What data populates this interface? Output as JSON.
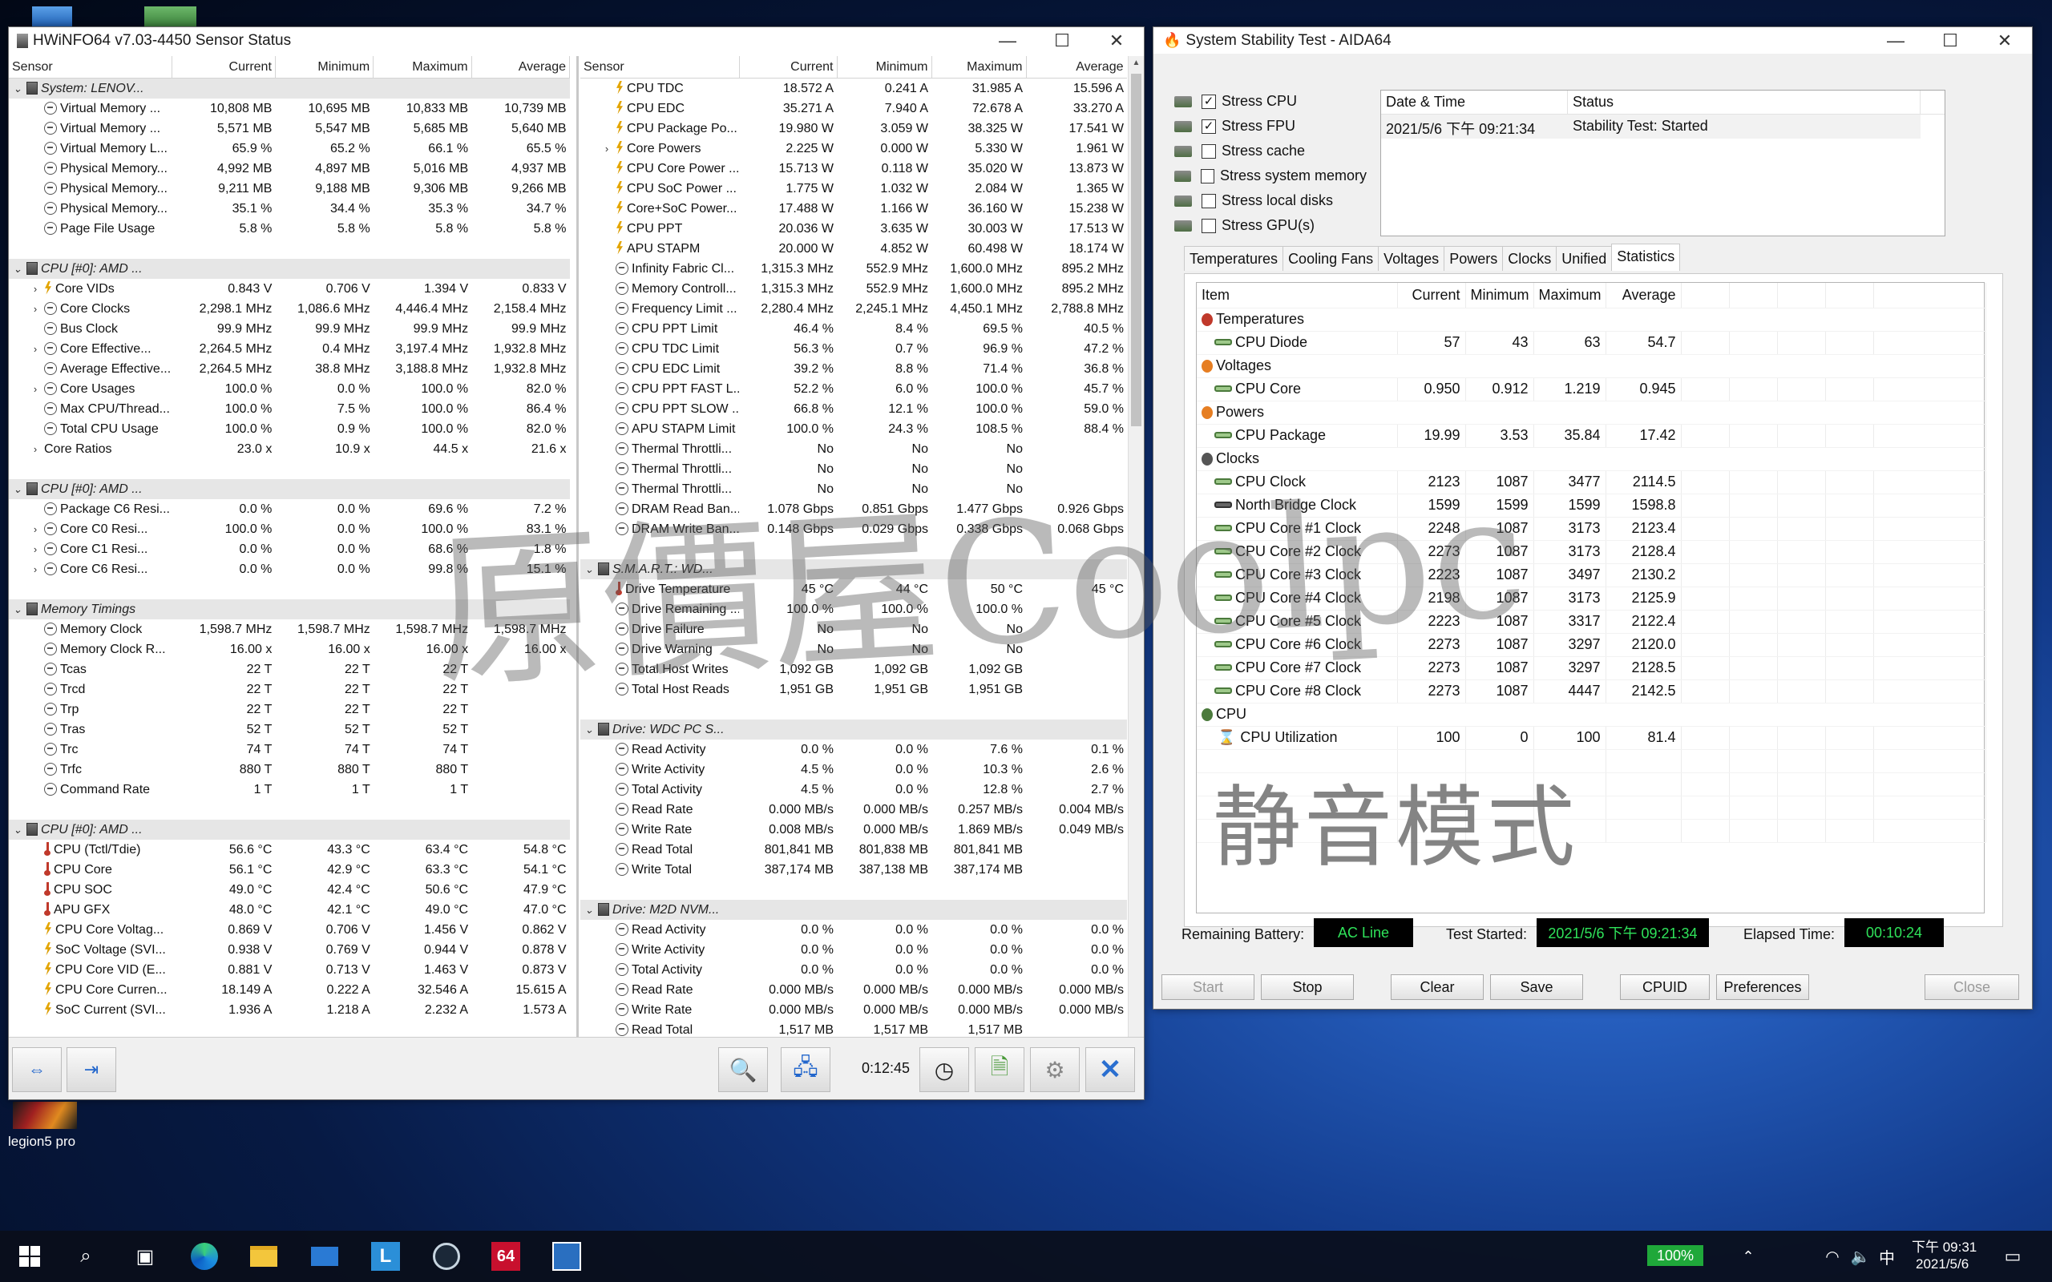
{
  "hwinfo": {
    "title": "HWiNFO64 v7.03-4450 Sensor Status",
    "columns": [
      "Sensor",
      "Current",
      "Minimum",
      "Maximum",
      "Average"
    ],
    "left_rows": [
      {
        "g": 1,
        "n": "System: LENOV..."
      },
      {
        "i": "clk",
        "n": "Virtual Memory ...",
        "v": [
          "10,808 MB",
          "10,695 MB",
          "10,833 MB",
          "10,739 MB"
        ]
      },
      {
        "i": "clk",
        "n": "Virtual Memory ...",
        "v": [
          "5,571 MB",
          "5,547 MB",
          "5,685 MB",
          "5,640 MB"
        ]
      },
      {
        "i": "clk",
        "n": "Virtual Memory L...",
        "v": [
          "65.9 %",
          "65.2 %",
          "66.1 %",
          "65.5 %"
        ]
      },
      {
        "i": "clk",
        "n": "Physical Memory...",
        "v": [
          "4,992 MB",
          "4,897 MB",
          "5,016 MB",
          "4,937 MB"
        ]
      },
      {
        "i": "clk",
        "n": "Physical Memory...",
        "v": [
          "9,211 MB",
          "9,188 MB",
          "9,306 MB",
          "9,266 MB"
        ]
      },
      {
        "i": "clk",
        "n": "Physical Memory...",
        "v": [
          "35.1 %",
          "34.4 %",
          "35.3 %",
          "34.7 %"
        ]
      },
      {
        "i": "clk",
        "n": "Page File Usage",
        "v": [
          "5.8 %",
          "5.8 %",
          "5.8 %",
          "5.8 %"
        ]
      },
      {
        "b": 1
      },
      {
        "g": 1,
        "n": "CPU [#0]: AMD ..."
      },
      {
        "x": 1,
        "i": "bolt",
        "n": "Core VIDs",
        "v": [
          "0.843 V",
          "0.706 V",
          "1.394 V",
          "0.833 V"
        ]
      },
      {
        "x": 1,
        "i": "clk",
        "n": "Core Clocks",
        "v": [
          "2,298.1 MHz",
          "1,086.6 MHz",
          "4,446.4 MHz",
          "2,158.4 MHz"
        ]
      },
      {
        "i": "clk",
        "n": "Bus Clock",
        "v": [
          "99.9 MHz",
          "99.9 MHz",
          "99.9 MHz",
          "99.9 MHz"
        ]
      },
      {
        "x": 1,
        "i": "clk",
        "n": "Core Effective...",
        "v": [
          "2,264.5 MHz",
          "0.4 MHz",
          "3,197.4 MHz",
          "1,932.8 MHz"
        ]
      },
      {
        "i": "clk",
        "n": "Average Effective...",
        "v": [
          "2,264.5 MHz",
          "38.8 MHz",
          "3,188.8 MHz",
          "1,932.8 MHz"
        ]
      },
      {
        "x": 1,
        "i": "clk",
        "n": "Core Usages",
        "v": [
          "100.0 %",
          "0.0 %",
          "100.0 %",
          "82.0 %"
        ]
      },
      {
        "i": "clk",
        "n": "Max CPU/Thread...",
        "v": [
          "100.0 %",
          "7.5 %",
          "100.0 %",
          "86.4 %"
        ]
      },
      {
        "i": "clk",
        "n": "Total CPU Usage",
        "v": [
          "100.0 %",
          "0.9 %",
          "100.0 %",
          "82.0 %"
        ]
      },
      {
        "x": 1,
        "n": "Core Ratios",
        "v": [
          "23.0 x",
          "10.9 x",
          "44.5 x",
          "21.6 x"
        ]
      },
      {
        "b": 1
      },
      {
        "g": 1,
        "n": "CPU [#0]: AMD ..."
      },
      {
        "i": "clk",
        "n": "Package C6 Resi...",
        "v": [
          "0.0 %",
          "0.0 %",
          "69.6 %",
          "7.2 %"
        ]
      },
      {
        "x": 1,
        "i": "clk",
        "n": "Core C0 Resi...",
        "v": [
          "100.0 %",
          "0.0 %",
          "100.0 %",
          "83.1 %"
        ]
      },
      {
        "x": 1,
        "i": "clk",
        "n": "Core C1 Resi...",
        "v": [
          "0.0 %",
          "0.0 %",
          "68.6 %",
          "1.8 %"
        ]
      },
      {
        "x": 1,
        "i": "clk",
        "n": "Core C6 Resi...",
        "v": [
          "0.0 %",
          "0.0 %",
          "99.8 %",
          "15.1 %"
        ]
      },
      {
        "b": 1
      },
      {
        "g": 1,
        "n": "Memory Timings"
      },
      {
        "i": "clk",
        "n": "Memory Clock",
        "v": [
          "1,598.7 MHz",
          "1,598.7 MHz",
          "1,598.7 MHz",
          "1,598.7 MHz"
        ]
      },
      {
        "i": "clk",
        "n": "Memory Clock R...",
        "v": [
          "16.00 x",
          "16.00 x",
          "16.00 x",
          "16.00 x"
        ]
      },
      {
        "i": "clk",
        "n": "Tcas",
        "v": [
          "22 T",
          "22 T",
          "22 T",
          ""
        ]
      },
      {
        "i": "clk",
        "n": "Trcd",
        "v": [
          "22 T",
          "22 T",
          "22 T",
          ""
        ]
      },
      {
        "i": "clk",
        "n": "Trp",
        "v": [
          "22 T",
          "22 T",
          "22 T",
          ""
        ]
      },
      {
        "i": "clk",
        "n": "Tras",
        "v": [
          "52 T",
          "52 T",
          "52 T",
          ""
        ]
      },
      {
        "i": "clk",
        "n": "Trc",
        "v": [
          "74 T",
          "74 T",
          "74 T",
          ""
        ]
      },
      {
        "i": "clk",
        "n": "Trfc",
        "v": [
          "880 T",
          "880 T",
          "880 T",
          ""
        ]
      },
      {
        "i": "clk",
        "n": "Command Rate",
        "v": [
          "1 T",
          "1 T",
          "1 T",
          ""
        ]
      },
      {
        "b": 1
      },
      {
        "g": 1,
        "n": "CPU [#0]: AMD ..."
      },
      {
        "i": "therm",
        "n": "CPU (Tctl/Tdie)",
        "v": [
          "56.6 °C",
          "43.3 °C",
          "63.4 °C",
          "54.8 °C"
        ]
      },
      {
        "i": "therm",
        "n": "CPU Core",
        "v": [
          "56.1 °C",
          "42.9 °C",
          "63.3 °C",
          "54.1 °C"
        ]
      },
      {
        "i": "therm",
        "n": "CPU SOC",
        "v": [
          "49.0 °C",
          "42.4 °C",
          "50.6 °C",
          "47.9 °C"
        ]
      },
      {
        "i": "therm",
        "n": "APU GFX",
        "v": [
          "48.0 °C",
          "42.1 °C",
          "49.0 °C",
          "47.0 °C"
        ]
      },
      {
        "i": "bolt",
        "n": "CPU Core Voltag...",
        "v": [
          "0.869 V",
          "0.706 V",
          "1.456 V",
          "0.862 V"
        ]
      },
      {
        "i": "bolt",
        "n": "SoC Voltage (SVI...",
        "v": [
          "0.938 V",
          "0.769 V",
          "0.944 V",
          "0.878 V"
        ]
      },
      {
        "i": "bolt",
        "n": "CPU Core VID (E...",
        "v": [
          "0.881 V",
          "0.713 V",
          "1.463 V",
          "0.873 V"
        ]
      },
      {
        "i": "bolt",
        "n": "CPU Core Curren...",
        "v": [
          "18.149 A",
          "0.222 A",
          "32.546 A",
          "15.615 A"
        ]
      },
      {
        "i": "bolt",
        "n": "SoC Current (SVI...",
        "v": [
          "1.936 A",
          "1.218 A",
          "2.232 A",
          "1.573 A"
        ]
      }
    ],
    "right_rows": [
      {
        "i": "bolt",
        "n": "CPU TDC",
        "v": [
          "18.572 A",
          "0.241 A",
          "31.985 A",
          "15.596 A"
        ]
      },
      {
        "i": "bolt",
        "n": "CPU EDC",
        "v": [
          "35.271 A",
          "7.940 A",
          "72.678 A",
          "33.270 A"
        ]
      },
      {
        "i": "bolt",
        "n": "CPU Package Po...",
        "v": [
          "19.980 W",
          "3.059 W",
          "38.325 W",
          "17.541 W"
        ]
      },
      {
        "x": 1,
        "i": "bolt",
        "n": "Core Powers",
        "v": [
          "2.225 W",
          "0.000 W",
          "5.330 W",
          "1.961 W"
        ]
      },
      {
        "i": "bolt",
        "n": "CPU Core Power ...",
        "v": [
          "15.713 W",
          "0.118 W",
          "35.020 W",
          "13.873 W"
        ]
      },
      {
        "i": "bolt",
        "n": "CPU SoC Power ...",
        "v": [
          "1.775 W",
          "1.032 W",
          "2.084 W",
          "1.365 W"
        ]
      },
      {
        "i": "bolt",
        "n": "Core+SoC Power...",
        "v": [
          "17.488 W",
          "1.166 W",
          "36.160 W",
          "15.238 W"
        ]
      },
      {
        "i": "bolt",
        "n": "CPU PPT",
        "v": [
          "20.036 W",
          "3.635 W",
          "30.003 W",
          "17.513 W"
        ]
      },
      {
        "i": "bolt",
        "n": "APU STAPM",
        "v": [
          "20.000 W",
          "4.852 W",
          "60.498 W",
          "18.174 W"
        ]
      },
      {
        "i": "clk",
        "n": "Infinity Fabric Cl...",
        "v": [
          "1,315.3 MHz",
          "552.9 MHz",
          "1,600.0 MHz",
          "895.2 MHz"
        ]
      },
      {
        "i": "clk",
        "n": "Memory Controll...",
        "v": [
          "1,315.3 MHz",
          "552.9 MHz",
          "1,600.0 MHz",
          "895.2 MHz"
        ]
      },
      {
        "i": "clk",
        "n": "Frequency Limit ...",
        "v": [
          "2,280.4 MHz",
          "2,245.1 MHz",
          "4,450.1 MHz",
          "2,788.8 MHz"
        ]
      },
      {
        "i": "clk",
        "n": "CPU PPT Limit",
        "v": [
          "46.4 %",
          "8.4 %",
          "69.5 %",
          "40.5 %"
        ]
      },
      {
        "i": "clk",
        "n": "CPU TDC Limit",
        "v": [
          "56.3 %",
          "0.7 %",
          "96.9 %",
          "47.2 %"
        ]
      },
      {
        "i": "clk",
        "n": "CPU EDC Limit",
        "v": [
          "39.2 %",
          "8.8 %",
          "71.4 %",
          "36.8 %"
        ]
      },
      {
        "i": "clk",
        "n": "CPU PPT FAST L...",
        "v": [
          "52.2 %",
          "6.0 %",
          "100.0 %",
          "45.7 %"
        ]
      },
      {
        "i": "clk",
        "n": "CPU PPT SLOW ...",
        "v": [
          "66.8 %",
          "12.1 %",
          "100.0 %",
          "59.0 %"
        ]
      },
      {
        "i": "clk",
        "n": "APU STAPM Limit",
        "v": [
          "100.0 %",
          "24.3 %",
          "108.5 %",
          "88.4 %"
        ]
      },
      {
        "i": "clk",
        "n": "Thermal Throttli...",
        "v": [
          "No",
          "No",
          "No",
          ""
        ]
      },
      {
        "i": "clk",
        "n": "Thermal Throttli...",
        "v": [
          "No",
          "No",
          "No",
          ""
        ]
      },
      {
        "i": "clk",
        "n": "Thermal Throttli...",
        "v": [
          "No",
          "No",
          "No",
          ""
        ]
      },
      {
        "i": "clk",
        "n": "DRAM Read Ban...",
        "v": [
          "1.078 Gbps",
          "0.851 Gbps",
          "1.477 Gbps",
          "0.926 Gbps"
        ]
      },
      {
        "i": "clk",
        "n": "DRAM Write Ban...",
        "v": [
          "0.148 Gbps",
          "0.029 Gbps",
          "0.338 Gbps",
          "0.068 Gbps"
        ]
      },
      {
        "b": 1
      },
      {
        "g": 1,
        "n": "S.M.A.R.T.: WD..."
      },
      {
        "i": "therm",
        "n": "Drive Temperature",
        "v": [
          "45 °C",
          "44 °C",
          "50 °C",
          "45 °C"
        ]
      },
      {
        "i": "clk",
        "n": "Drive Remaining ...",
        "v": [
          "100.0 %",
          "100.0 %",
          "100.0 %",
          ""
        ]
      },
      {
        "i": "clk",
        "n": "Drive Failure",
        "v": [
          "No",
          "No",
          "No",
          ""
        ]
      },
      {
        "i": "clk",
        "n": "Drive Warning",
        "v": [
          "No",
          "No",
          "No",
          ""
        ]
      },
      {
        "i": "clk",
        "n": "Total Host Writes",
        "v": [
          "1,092 GB",
          "1,092 GB",
          "1,092 GB",
          ""
        ]
      },
      {
        "i": "clk",
        "n": "Total Host Reads",
        "v": [
          "1,951 GB",
          "1,951 GB",
          "1,951 GB",
          ""
        ]
      },
      {
        "b": 1
      },
      {
        "g": 1,
        "n": "Drive: WDC PC S..."
      },
      {
        "i": "clk",
        "n": "Read Activity",
        "v": [
          "0.0 %",
          "0.0 %",
          "7.6 %",
          "0.1 %"
        ]
      },
      {
        "i": "clk",
        "n": "Write Activity",
        "v": [
          "4.5 %",
          "0.0 %",
          "10.3 %",
          "2.6 %"
        ]
      },
      {
        "i": "clk",
        "n": "Total Activity",
        "v": [
          "4.5 %",
          "0.0 %",
          "12.8 %",
          "2.7 %"
        ]
      },
      {
        "i": "clk",
        "n": "Read Rate",
        "v": [
          "0.000 MB/s",
          "0.000 MB/s",
          "0.257 MB/s",
          "0.004 MB/s"
        ]
      },
      {
        "i": "clk",
        "n": "Write Rate",
        "v": [
          "0.008 MB/s",
          "0.000 MB/s",
          "1.869 MB/s",
          "0.049 MB/s"
        ]
      },
      {
        "i": "clk",
        "n": "Read Total",
        "v": [
          "801,841 MB",
          "801,838 MB",
          "801,841 MB",
          ""
        ]
      },
      {
        "i": "clk",
        "n": "Write Total",
        "v": [
          "387,174 MB",
          "387,138 MB",
          "387,174 MB",
          ""
        ]
      },
      {
        "b": 1
      },
      {
        "g": 1,
        "n": "Drive: M2D NVM..."
      },
      {
        "i": "clk",
        "n": "Read Activity",
        "v": [
          "0.0 %",
          "0.0 %",
          "0.0 %",
          "0.0 %"
        ]
      },
      {
        "i": "clk",
        "n": "Write Activity",
        "v": [
          "0.0 %",
          "0.0 %",
          "0.0 %",
          "0.0 %"
        ]
      },
      {
        "i": "clk",
        "n": "Total Activity",
        "v": [
          "0.0 %",
          "0.0 %",
          "0.0 %",
          "0.0 %"
        ]
      },
      {
        "i": "clk",
        "n": "Read Rate",
        "v": [
          "0.000 MB/s",
          "0.000 MB/s",
          "0.000 MB/s",
          "0.000 MB/s"
        ]
      },
      {
        "i": "clk",
        "n": "Write Rate",
        "v": [
          "0.000 MB/s",
          "0.000 MB/s",
          "0.000 MB/s",
          "0.000 MB/s"
        ]
      },
      {
        "i": "clk",
        "n": "Read Total",
        "v": [
          "1,517 MB",
          "1,517 MB",
          "1,517 MB",
          ""
        ]
      }
    ],
    "elapsed": "0:12:45"
  },
  "aida": {
    "title": "System Stability Test - AIDA64",
    "stress": [
      {
        "label": "Stress CPU",
        "checked": true
      },
      {
        "label": "Stress FPU",
        "checked": true
      },
      {
        "label": "Stress cache",
        "checked": false
      },
      {
        "label": "Stress system memory",
        "checked": false
      },
      {
        "label": "Stress local disks",
        "checked": false
      },
      {
        "label": "Stress GPU(s)",
        "checked": false
      }
    ],
    "log_headers": [
      "Date & Time",
      "Status"
    ],
    "log_row": [
      "2021/5/6 下午 09:21:34",
      "Stability Test: Started"
    ],
    "tabs": [
      "Temperatures",
      "Cooling Fans",
      "Voltages",
      "Powers",
      "Clocks",
      "Unified",
      "Statistics"
    ],
    "active_tab": "Statistics",
    "stat_headers": [
      "Item",
      "Current",
      "Minimum",
      "Maximum",
      "Average"
    ],
    "stat_rows": [
      {
        "c": "temp",
        "n": "Temperatures"
      },
      {
        "l": 1,
        "n": "CPU Diode",
        "v": [
          "57",
          "43",
          "63",
          "54.7"
        ]
      },
      {
        "c": "volt",
        "n": "Voltages"
      },
      {
        "l": 1,
        "n": "CPU Core",
        "v": [
          "0.950",
          "0.912",
          "1.219",
          "0.945"
        ]
      },
      {
        "c": "pow",
        "n": "Powers"
      },
      {
        "l": 1,
        "n": "CPU Package",
        "v": [
          "19.99",
          "3.53",
          "35.84",
          "17.42"
        ]
      },
      {
        "c": "clk",
        "n": "Clocks"
      },
      {
        "l": 1,
        "n": "CPU Clock",
        "v": [
          "2123",
          "1087",
          "3477",
          "2114.5"
        ]
      },
      {
        "l": 2,
        "n": "North Bridge Clock",
        "v": [
          "1599",
          "1599",
          "1599",
          "1598.8"
        ]
      },
      {
        "l": 1,
        "n": "CPU Core #1 Clock",
        "v": [
          "2248",
          "1087",
          "3173",
          "2123.4"
        ]
      },
      {
        "l": 1,
        "n": "CPU Core #2 Clock",
        "v": [
          "2273",
          "1087",
          "3173",
          "2128.4"
        ]
      },
      {
        "l": 1,
        "n": "CPU Core #3 Clock",
        "v": [
          "2223",
          "1087",
          "3497",
          "2130.2"
        ]
      },
      {
        "l": 1,
        "n": "CPU Core #4 Clock",
        "v": [
          "2198",
          "1087",
          "3173",
          "2125.9"
        ]
      },
      {
        "l": 1,
        "n": "CPU Core #5 Clock",
        "v": [
          "2223",
          "1087",
          "3317",
          "2122.4"
        ]
      },
      {
        "l": 1,
        "n": "CPU Core #6 Clock",
        "v": [
          "2273",
          "1087",
          "3297",
          "2120.0"
        ]
      },
      {
        "l": 1,
        "n": "CPU Core #7 Clock",
        "v": [
          "2273",
          "1087",
          "3297",
          "2128.5"
        ]
      },
      {
        "l": 1,
        "n": "CPU Core #8 Clock",
        "v": [
          "2273",
          "1087",
          "4447",
          "2142.5"
        ]
      },
      {
        "c": "cpu",
        "n": "CPU"
      },
      {
        "l": 3,
        "n": "CPU Utilization",
        "v": [
          "100",
          "0",
          "100",
          "81.4"
        ]
      }
    ],
    "overlay_text": "静音模式",
    "battery_label": "Remaining Battery:",
    "battery_value": "AC Line",
    "started_label": "Test Started:",
    "started_value": "2021/5/6 下午 09:21:34",
    "elapsed_label": "Elapsed Time:",
    "elapsed_value": "00:10:24",
    "buttons": [
      "Start",
      "Stop",
      "Clear",
      "Save",
      "CPUID",
      "Preferences",
      "Close"
    ]
  },
  "watermark": "原價屋Coolpc",
  "desktop": {
    "icon_label": "legion5 pro"
  },
  "taskbar": {
    "battery": "100%",
    "ime": "中",
    "time": "下午 09:31",
    "date": "2021/5/6"
  }
}
